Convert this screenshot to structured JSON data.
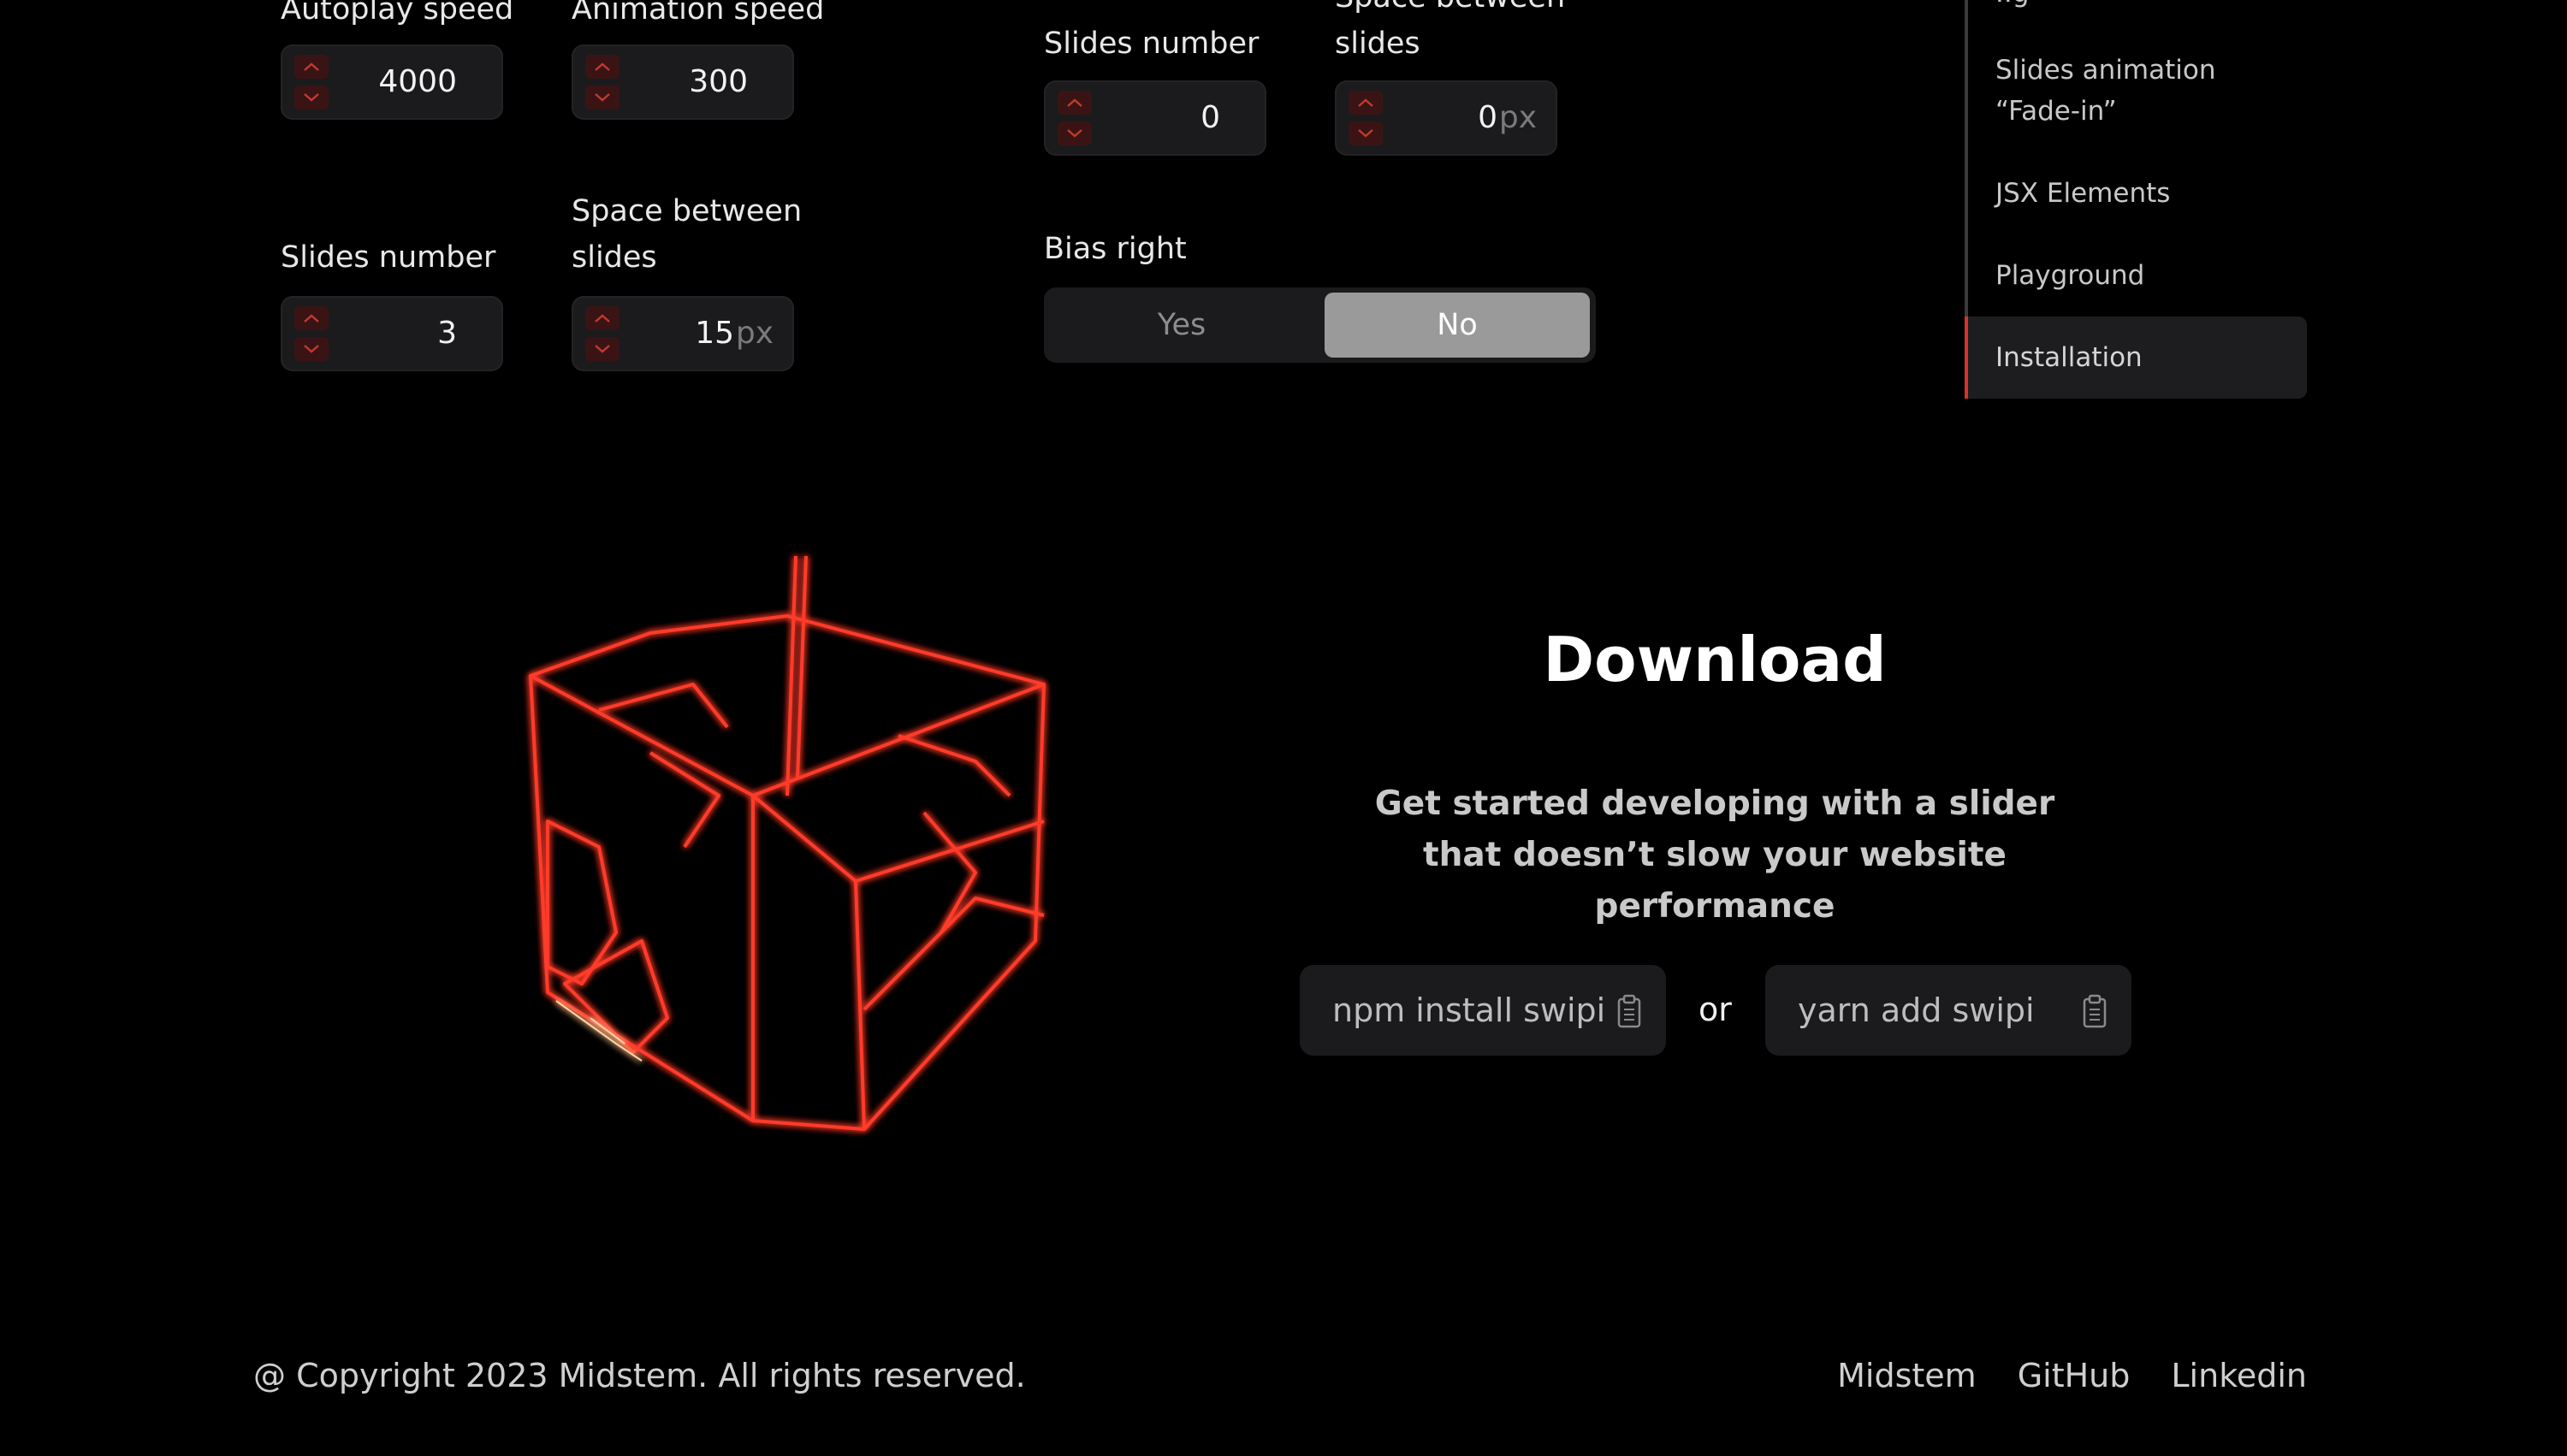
{
  "left_controls": {
    "autoplay_speed": {
      "label": "Autoplay speed",
      "value": "4000"
    },
    "animation_speed": {
      "label": "Animation speed",
      "value": "300"
    },
    "slides_number": {
      "label": "Slides number",
      "value": "3"
    },
    "space_between": {
      "label": "Space between slides",
      "value": "15",
      "unit": "px"
    }
  },
  "right_controls": {
    "slides_number": {
      "label": "Slides number",
      "value": "0"
    },
    "space_between": {
      "label": "Space between slides",
      "value": "0",
      "unit": "px"
    },
    "bias_right": {
      "label": "Bias right",
      "options": [
        "Yes",
        "No"
      ],
      "selected": "No"
    }
  },
  "sidebar": {
    "items": [
      {
        "label": "Slides animation “Fade-in”"
      },
      {
        "label": "JSX Elements"
      },
      {
        "label": "Playground"
      },
      {
        "label": "Installation",
        "active": true
      }
    ]
  },
  "download": {
    "title": "Download",
    "subtitle": "Get started developing with a slider that doesn’t slow your website performance",
    "npm_command": "npm install swipi",
    "or_text": "or",
    "yarn_command": "yarn add swipi"
  },
  "footer": {
    "copyright": "@ Copyright 2023 Midstem. All rights reserved.",
    "links": [
      "Midstem",
      "GitHub",
      "Linkedin"
    ]
  },
  "colors": {
    "accent": "#d9322b",
    "background": "#000000",
    "field_bg": "#1b1b1d",
    "toggle_selected": "#9a9a9a"
  }
}
